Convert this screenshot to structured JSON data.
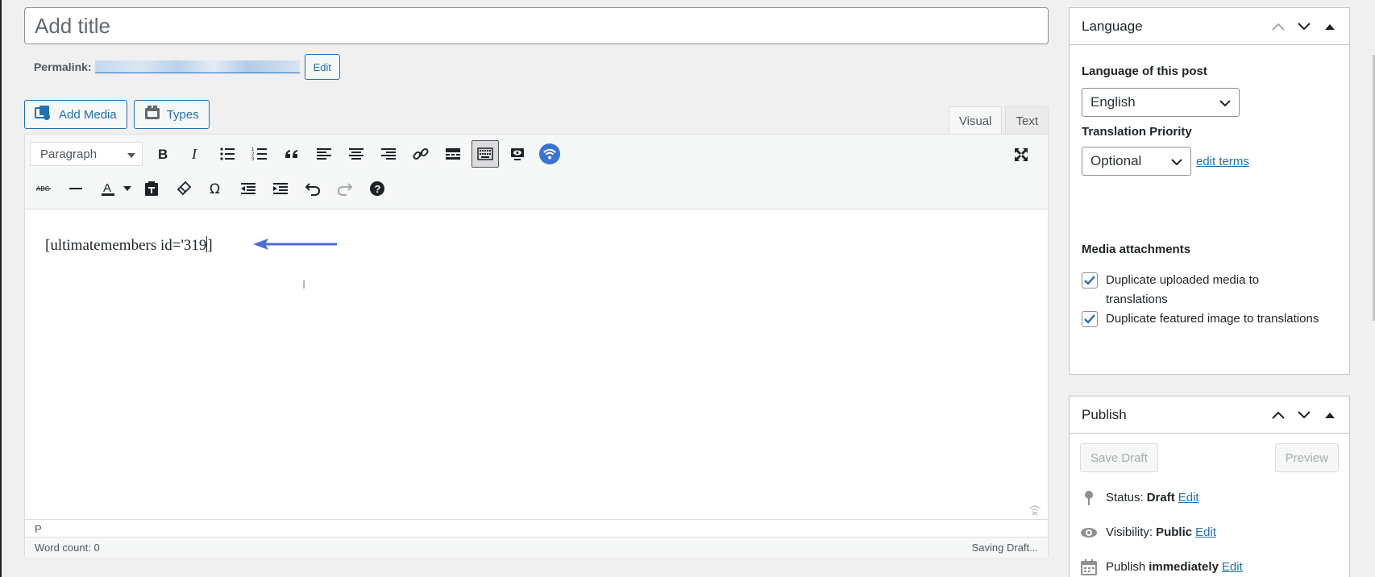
{
  "editor": {
    "title_placeholder": "Add title",
    "permalink_label": "Permalink:",
    "permalink_edit": "Edit",
    "add_media": "Add Media",
    "types": "Types",
    "tabs": [
      "Visual",
      "Text"
    ],
    "format_select": "Paragraph",
    "content": "[ultimatemembers id='319",
    "content_tail": "]",
    "path": "P",
    "word_count": "Word count: 0",
    "save_status": "Saving Draft...",
    "toolbar_row1_icons": [
      "bold-icon",
      "italic-icon",
      "bulleted-list-icon",
      "numbered-list-icon",
      "blockquote-icon",
      "align-left-icon",
      "align-center-icon",
      "align-right-icon",
      "link-icon",
      "read-more-icon",
      "toolbar-toggle-icon",
      "preview-icon",
      "wifi-icon"
    ],
    "toolbar_row2_icons": [
      "strikethrough-icon",
      "horizontal-line-icon",
      "text-color-icon",
      "paste-text-icon",
      "clear-formatting-icon",
      "special-character-icon",
      "outdent-icon",
      "indent-icon",
      "undo-icon",
      "redo-icon",
      "help-icon"
    ]
  },
  "language_panel": {
    "title": "Language",
    "language_label": "Language of this post",
    "language_value": "English",
    "priority_label": "Translation Priority",
    "priority_value": "Optional",
    "edit_terms": "edit terms",
    "media_label": "Media attachments",
    "chk_media": "Duplicate uploaded media to translations",
    "chk_featured": "Duplicate featured image to translations"
  },
  "publish_panel": {
    "title": "Publish",
    "save_draft": "Save Draft",
    "preview": "Preview",
    "status_label": "Status:",
    "status_value": "Draft",
    "visibility_label": "Visibility:",
    "visibility_value": "Public",
    "publish_label": "Publish",
    "publish_value": "immediately",
    "edit": "Edit"
  },
  "colors": {
    "accent": "#2271b1",
    "arrow": "#4a6fdc",
    "wifi_button": "#3b73d6"
  }
}
